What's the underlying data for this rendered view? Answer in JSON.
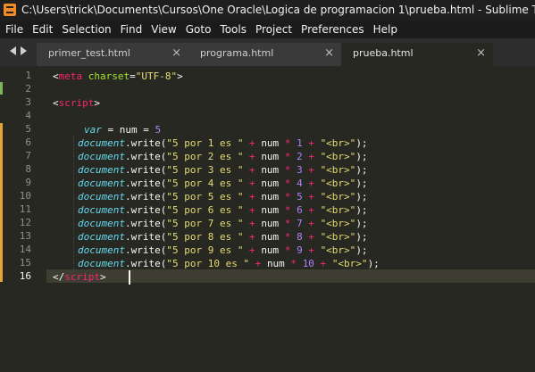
{
  "window": {
    "title": "C:\\Users\\trick\\Documents\\Cursos\\One Oracle\\Logica de programacion 1\\prueba.html - Sublime Text (UNREGISTERED)"
  },
  "menu": [
    "File",
    "Edit",
    "Selection",
    "Find",
    "View",
    "Goto",
    "Tools",
    "Project",
    "Preferences",
    "Help"
  ],
  "tabs": [
    {
      "label": "primer_test.html"
    },
    {
      "label": "programa.html"
    },
    {
      "label": "prueba.html",
      "active": true
    }
  ],
  "icons": {
    "close": "×",
    "nav_left": "triangle-left",
    "nav_right": "triangle-right"
  },
  "gutter": {
    "numbers": [
      "1",
      "2",
      "3",
      "4",
      "5",
      "6",
      "7",
      "8",
      "9",
      "10",
      "11",
      "12",
      "13",
      "14",
      "15",
      "16"
    ],
    "current_line": "16"
  },
  "code": {
    "l1": {
      "open": "<",
      "tag": "meta",
      "attr": "charset",
      "eq": "=",
      "val": "\"UTF-8\"",
      "close": ">"
    },
    "l3": {
      "open": "<",
      "tag": "script",
      "close": ">"
    },
    "l5": {
      "kw": "var",
      "rest": " = num = ",
      "num": "5"
    },
    "write_lines": [
      {
        "obj": "document",
        "fn": ".write(",
        "s1": "\"5 por 1 es \"",
        "p1": " + ",
        "v": "num",
        "m": " * ",
        "n": "1",
        "p2": " + ",
        "s2": "\"<br>\"",
        "end": ");"
      },
      {
        "obj": "document",
        "fn": ".write(",
        "s1": "\"5 por 2 es \"",
        "p1": " + ",
        "v": "num",
        "m": " * ",
        "n": "2",
        "p2": " + ",
        "s2": "\"<br>\"",
        "end": ");"
      },
      {
        "obj": "document",
        "fn": ".write(",
        "s1": "\"5 por 3 es \"",
        "p1": " + ",
        "v": "num",
        "m": " * ",
        "n": "3",
        "p2": " + ",
        "s2": "\"<br>\"",
        "end": ");"
      },
      {
        "obj": "document",
        "fn": ".write(",
        "s1": "\"5 por 4 es \"",
        "p1": " + ",
        "v": "num",
        "m": " * ",
        "n": "4",
        "p2": " + ",
        "s2": "\"<br>\"",
        "end": ");"
      },
      {
        "obj": "document",
        "fn": ".write(",
        "s1": "\"5 por 5 es \"",
        "p1": " + ",
        "v": "num",
        "m": " * ",
        "n": "5",
        "p2": " + ",
        "s2": "\"<br>\"",
        "end": ");"
      },
      {
        "obj": "document",
        "fn": ".write(",
        "s1": "\"5 por 6 es \"",
        "p1": " + ",
        "v": "num",
        "m": " * ",
        "n": "6",
        "p2": " + ",
        "s2": "\"<br>\"",
        "end": ");"
      },
      {
        "obj": "document",
        "fn": ".write(",
        "s1": "\"5 por 7 es \"",
        "p1": " + ",
        "v": "num",
        "m": " * ",
        "n": "7",
        "p2": " + ",
        "s2": "\"<br>\"",
        "end": ");"
      },
      {
        "obj": "document",
        "fn": ".write(",
        "s1": "\"5 por 8 es \"",
        "p1": " + ",
        "v": "num",
        "m": " * ",
        "n": "8",
        "p2": " + ",
        "s2": "\"<br>\"",
        "end": ");"
      },
      {
        "obj": "document",
        "fn": ".write(",
        "s1": "\"5 por 9 es \"",
        "p1": " + ",
        "v": "num",
        "m": " * ",
        "n": "9",
        "p2": " + ",
        "s2": "\"<br>\"",
        "end": ");"
      },
      {
        "obj": "document",
        "fn": ".write(",
        "s1": "\"5 por 10 es \"",
        "p1": " + ",
        "v": "num",
        "m": " * ",
        "n": "10",
        "p2": " + ",
        "s2": "\"<br>\"",
        "end": ");"
      }
    ],
    "l16": {
      "open": "</",
      "tag": "script",
      "close": ">"
    }
  },
  "colors": {
    "background": "#272822",
    "tag": "#f92672",
    "attribute": "#a6e22e",
    "string": "#e6db74",
    "keyword": "#66d9ef",
    "number": "#ae81ff",
    "modified_marker": "#e5a434",
    "added_marker": "#7fb45a"
  }
}
